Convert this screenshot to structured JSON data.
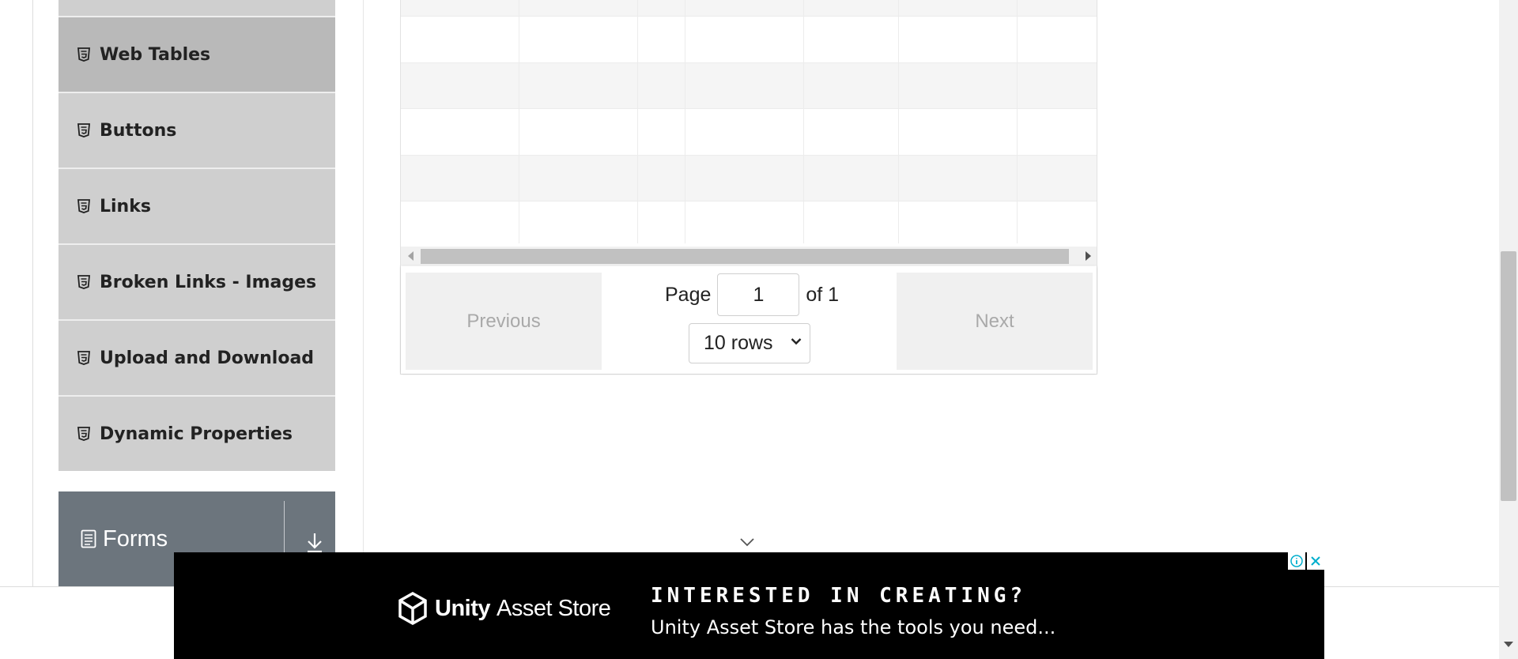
{
  "sidebar": {
    "items": [
      {
        "label": "Web Tables",
        "icon": "html5-icon",
        "active": true
      },
      {
        "label": "Buttons",
        "icon": "html5-icon"
      },
      {
        "label": "Links",
        "icon": "html5-icon"
      },
      {
        "label": "Broken Links - Images",
        "icon": "html5-icon"
      },
      {
        "label": "Upload and Download",
        "icon": "html5-icon"
      },
      {
        "label": "Dynamic Properties",
        "icon": "html5-icon"
      }
    ],
    "group": {
      "label": "Forms",
      "icon": "form-icon",
      "action_icon": "download-arrow-icon"
    }
  },
  "pagination": {
    "previous_label": "Previous",
    "next_label": "Next",
    "page_label": "Page",
    "page_value": "1",
    "of_label": "of 1",
    "rows_option": "10 rows"
  },
  "ad": {
    "brand_bold": "Unity",
    "brand_light": "Asset Store",
    "headline": "INTERESTED IN CREATING?",
    "subline": "Unity Asset Store has the tools you need..."
  },
  "colors": {
    "sidebar_item": "#cfcfcf",
    "sidebar_item_active": "#b9b9b9",
    "group_header": "#6c757d",
    "ad_background": "#000000"
  }
}
